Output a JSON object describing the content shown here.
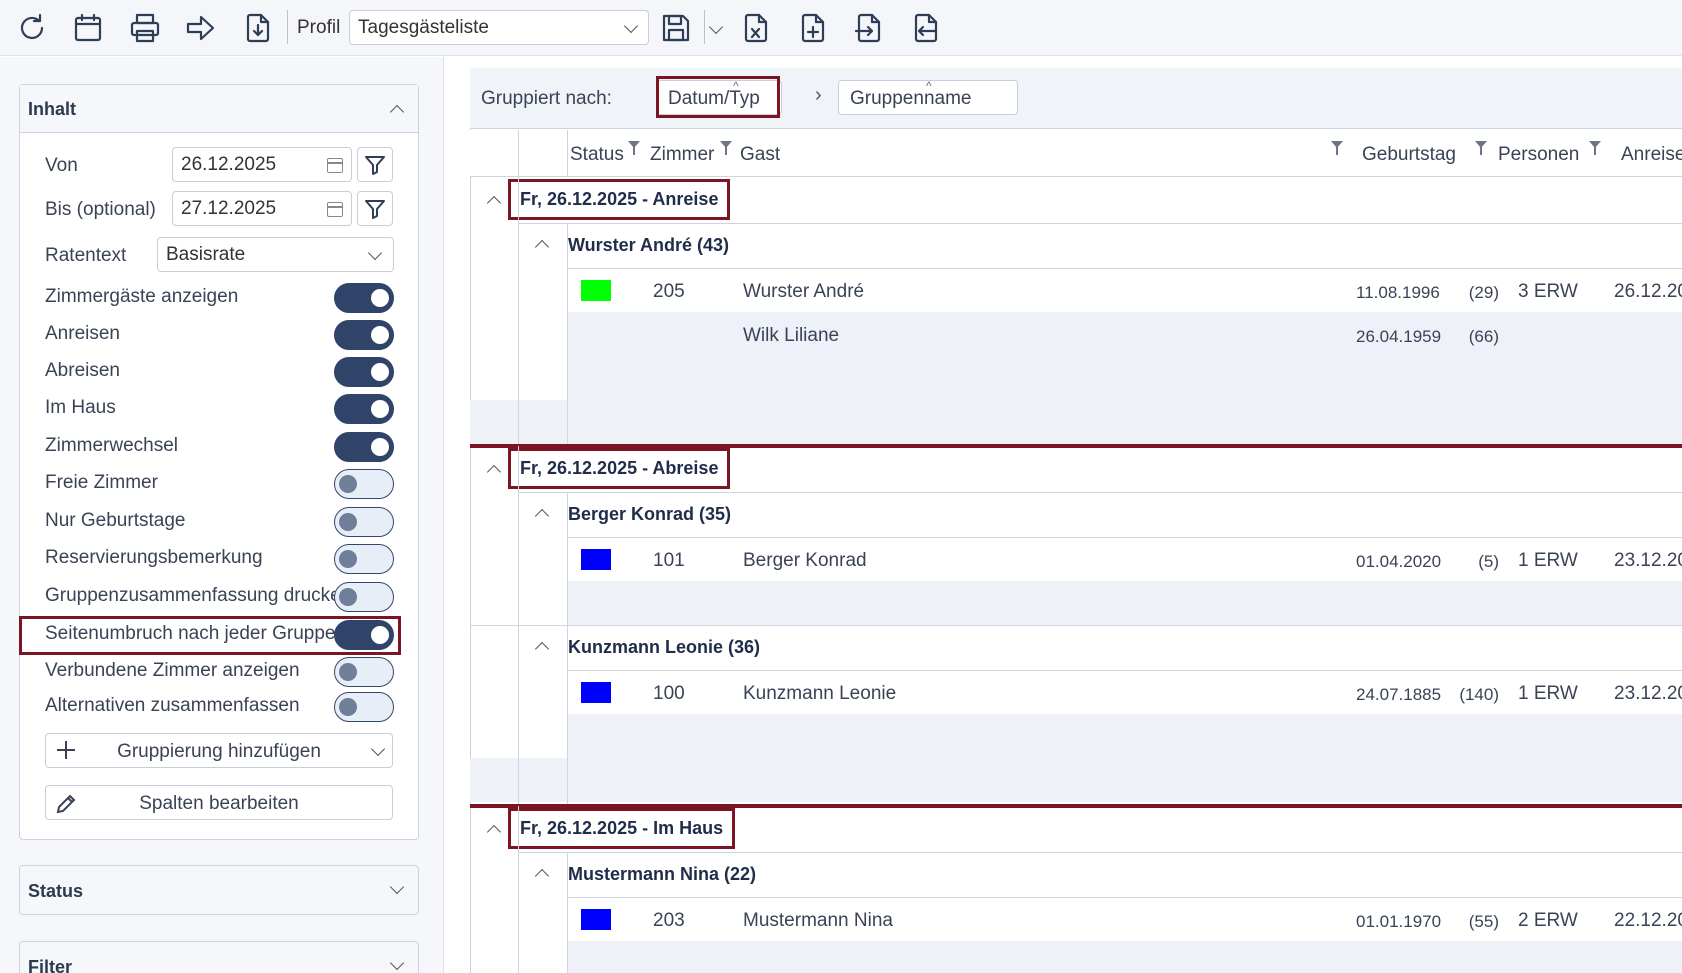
{
  "toolbar": {
    "icons": [
      "refresh-icon",
      "calendar-icon",
      "print-icon",
      "forward-icon",
      "download-icon",
      "save-icon",
      "excel-export-icon",
      "add-file-icon",
      "import-icon",
      "export-icon"
    ],
    "profil_label": "Profil",
    "profil_value": "Tagesgästeliste"
  },
  "sidebar": {
    "inhalt_title": "Inhalt",
    "von_label": "Von",
    "von_value": "26.12.2025",
    "bis_label": "Bis (optional)",
    "bis_value": "27.12.2025",
    "ratentext_label": "Ratentext",
    "ratentext_value": "Basisrate",
    "toggles": [
      {
        "label": "Zimmergäste anzeigen",
        "on": true
      },
      {
        "label": "Anreisen",
        "on": true
      },
      {
        "label": "Abreisen",
        "on": true
      },
      {
        "label": "Im Haus",
        "on": true
      },
      {
        "label": "Zimmerwechsel",
        "on": true
      },
      {
        "label": "Freie Zimmer",
        "on": false
      },
      {
        "label": "Nur Geburtstage",
        "on": false
      },
      {
        "label": "Reservierungsbemerkung",
        "on": false
      },
      {
        "label": "Gruppenzusammenfassung drucken",
        "on": false
      },
      {
        "label": "Seitenumbruch nach jeder Gruppe",
        "on": true
      },
      {
        "label": "Verbundene Zimmer anzeigen",
        "on": false
      },
      {
        "label": "Alternativen zusammenfassen",
        "on": false
      }
    ],
    "add_grouping_label": "Gruppierung hinzufügen",
    "edit_columns_label": "Spalten bearbeiten",
    "status_title": "Status",
    "filter_title": "Filter"
  },
  "grouping": {
    "label": "Gruppiert nach:",
    "chip1": "Datum/Typ",
    "chip2": "Gruppenname"
  },
  "columns": {
    "status": "Status",
    "zimmer": "Zimmer",
    "gast": "Gast",
    "geburtstag": "Geburtstag",
    "personen": "Personen",
    "anreise": "Anreise"
  },
  "groups": [
    {
      "title": "Fr, 26.12.2025 - Anreise",
      "subgroups": [
        {
          "title": "Wurster André (43)",
          "rows": [
            {
              "status_color": "#00ff00",
              "zimmer": "205",
              "gast": "Wurster André",
              "geburtstag": "11.08.1996",
              "alter": "(29)",
              "personen": "3 ERW",
              "anreise": "26.12.20"
            },
            {
              "status_color": "",
              "zimmer": "",
              "gast": "Wilk Liliane",
              "geburtstag": "26.04.1959",
              "alter": "(66)",
              "personen": "",
              "anreise": ""
            }
          ]
        }
      ]
    },
    {
      "title": "Fr, 26.12.2025 - Abreise",
      "subgroups": [
        {
          "title": "Berger Konrad (35)",
          "rows": [
            {
              "status_color": "#0000ff",
              "zimmer": "101",
              "gast": "Berger Konrad",
              "geburtstag": "01.04.2020",
              "alter": "(5)",
              "personen": "1 ERW",
              "anreise": "23.12.20"
            }
          ]
        },
        {
          "title": "Kunzmann Leonie (36)",
          "rows": [
            {
              "status_color": "#0000ff",
              "zimmer": "100",
              "gast": "Kunzmann Leonie",
              "geburtstag": "24.07.1885",
              "alter": "(140)",
              "personen": "1 ERW",
              "anreise": "23.12.20"
            }
          ]
        }
      ]
    },
    {
      "title": "Fr, 26.12.2025 - Im Haus",
      "subgroups": [
        {
          "title": "Mustermann Nina (22)",
          "rows": [
            {
              "status_color": "#0000ff",
              "zimmer": "203",
              "gast": "Mustermann Nina",
              "geburtstag": "01.01.1970",
              "alter": "(55)",
              "personen": "2 ERW",
              "anreise": "22.12.20"
            }
          ]
        }
      ]
    }
  ]
}
